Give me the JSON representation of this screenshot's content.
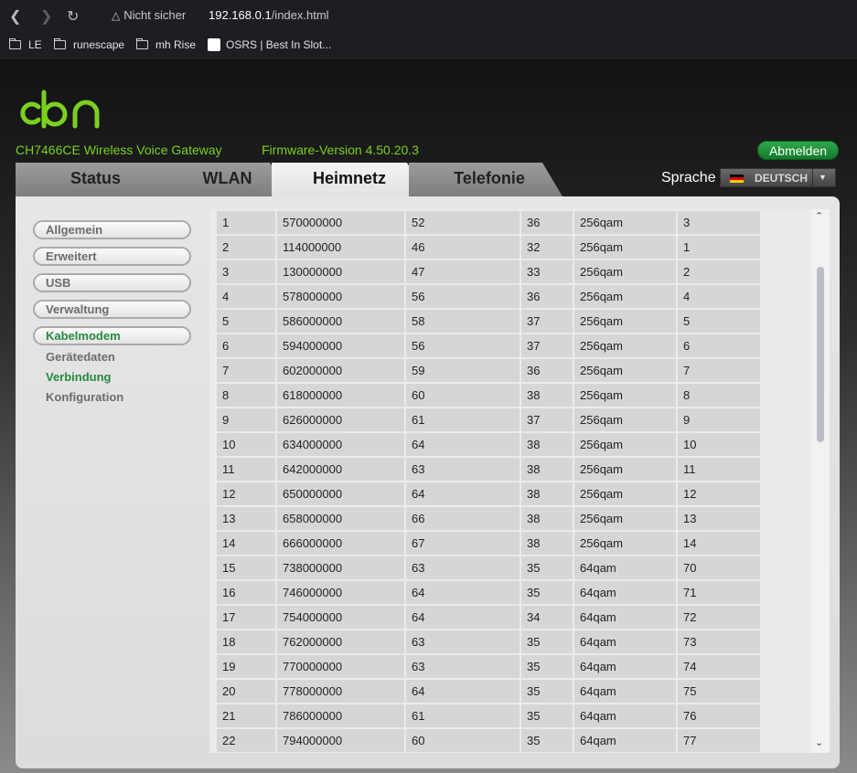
{
  "browser": {
    "security_label": "Nicht sicher",
    "url_host": "192.168.0.1",
    "url_path": "/index.html",
    "bookmarks": [
      {
        "label": "LE",
        "icon": "folder-icon"
      },
      {
        "label": "runescape",
        "icon": "folder-icon"
      },
      {
        "label": "mh Rise",
        "icon": "folder-icon"
      },
      {
        "label": "OSRS | Best In Slot...",
        "icon": "page-icon"
      }
    ]
  },
  "header": {
    "model": "CH7466CE  Wireless Voice Gateway",
    "firmware": "Firmware-Version  4.50.20.3",
    "logout_label": "Abmelden",
    "language_label": "Sprache",
    "language_value": "DEUTSCH",
    "accent_color": "#7bd01f"
  },
  "tabs": [
    {
      "label": "Status",
      "active": false
    },
    {
      "label": "WLAN",
      "active": false
    },
    {
      "label": "Heimnetz",
      "active": true
    },
    {
      "label": "Telefonie",
      "active": false
    }
  ],
  "sidebar": {
    "buttons": [
      {
        "label": "Allgemein",
        "active": false
      },
      {
        "label": "Erweitert",
        "active": false
      },
      {
        "label": "USB",
        "active": false
      },
      {
        "label": "Verwaltung",
        "active": false
      },
      {
        "label": "Kabelmodem",
        "active": true
      }
    ],
    "subitems": [
      {
        "label": "Gerätedaten",
        "active": false
      },
      {
        "label": "Verbindung",
        "active": true
      },
      {
        "label": "Konfiguration",
        "active": false
      }
    ]
  },
  "downstream_rows": [
    [
      "1",
      "570000000",
      "52",
      "36",
      "256qam",
      "3"
    ],
    [
      "2",
      "114000000",
      "46",
      "32",
      "256qam",
      "1"
    ],
    [
      "3",
      "130000000",
      "47",
      "33",
      "256qam",
      "2"
    ],
    [
      "4",
      "578000000",
      "56",
      "36",
      "256qam",
      "4"
    ],
    [
      "5",
      "586000000",
      "58",
      "37",
      "256qam",
      "5"
    ],
    [
      "6",
      "594000000",
      "56",
      "37",
      "256qam",
      "6"
    ],
    [
      "7",
      "602000000",
      "59",
      "36",
      "256qam",
      "7"
    ],
    [
      "8",
      "618000000",
      "60",
      "38",
      "256qam",
      "8"
    ],
    [
      "9",
      "626000000",
      "61",
      "37",
      "256qam",
      "9"
    ],
    [
      "10",
      "634000000",
      "64",
      "38",
      "256qam",
      "10"
    ],
    [
      "11",
      "642000000",
      "63",
      "38",
      "256qam",
      "11"
    ],
    [
      "12",
      "650000000",
      "64",
      "38",
      "256qam",
      "12"
    ],
    [
      "13",
      "658000000",
      "66",
      "38",
      "256qam",
      "13"
    ],
    [
      "14",
      "666000000",
      "67",
      "38",
      "256qam",
      "14"
    ],
    [
      "15",
      "738000000",
      "63",
      "35",
      "64qam",
      "70"
    ],
    [
      "16",
      "746000000",
      "64",
      "35",
      "64qam",
      "71"
    ],
    [
      "17",
      "754000000",
      "64",
      "34",
      "64qam",
      "72"
    ],
    [
      "18",
      "762000000",
      "63",
      "35",
      "64qam",
      "73"
    ],
    [
      "19",
      "770000000",
      "63",
      "35",
      "64qam",
      "74"
    ],
    [
      "20",
      "778000000",
      "64",
      "35",
      "64qam",
      "75"
    ],
    [
      "21",
      "786000000",
      "61",
      "35",
      "64qam",
      "76"
    ],
    [
      "22",
      "794000000",
      "60",
      "35",
      "64qam",
      "77"
    ]
  ]
}
